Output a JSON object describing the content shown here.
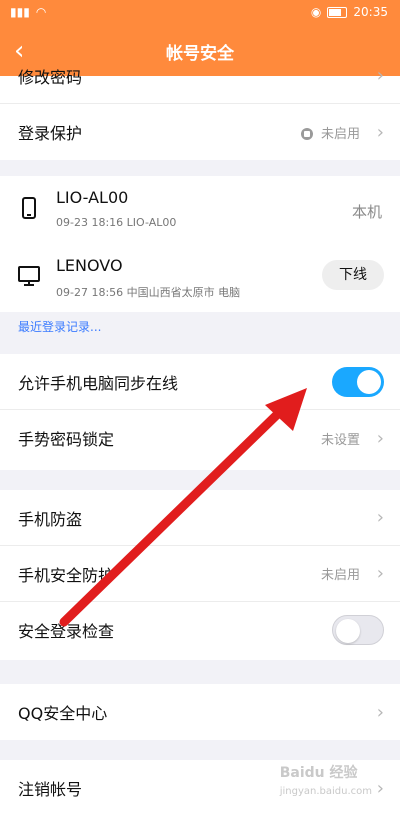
{
  "status": {
    "left": "ᯤ",
    "time": "20:35"
  },
  "header": {
    "title": "帐号安全",
    "back_icon": "chevron-left-icon"
  },
  "top_row": {
    "label": "修改密码"
  },
  "login_protect": {
    "label": "登录保护",
    "value": "未启用"
  },
  "devices": [
    {
      "name": "LIO-AL00",
      "info": "09-23 18:16 LIO-AL00",
      "tag": "本机",
      "icon": "phone-icon"
    },
    {
      "name": "LENOVO",
      "info": "09-27 18:56 中国山西省太原市 电脑",
      "action": "下线",
      "icon": "monitor-icon"
    }
  ],
  "recent_login": "最近登录记录...",
  "sync_online": {
    "label": "允许手机电脑同步在线",
    "on": true
  },
  "gesture_lock": {
    "label": "手势密码锁定",
    "value": "未设置"
  },
  "anti_theft": {
    "label": "手机防盗"
  },
  "phone_protect": {
    "label": "手机安全防护",
    "value": "未启用"
  },
  "safe_login_check": {
    "label": "安全登录检查",
    "on": false
  },
  "qq_security": {
    "label": "QQ安全中心"
  },
  "cancel_account": {
    "label": "注销帐号"
  },
  "watermark": {
    "text": "Baidu 经验",
    "sub": "jingyan.baidu.com"
  },
  "colors": {
    "header": "#ff8a3c",
    "toggle_on": "#1aa8ff",
    "arrow": "#e11d1d"
  }
}
